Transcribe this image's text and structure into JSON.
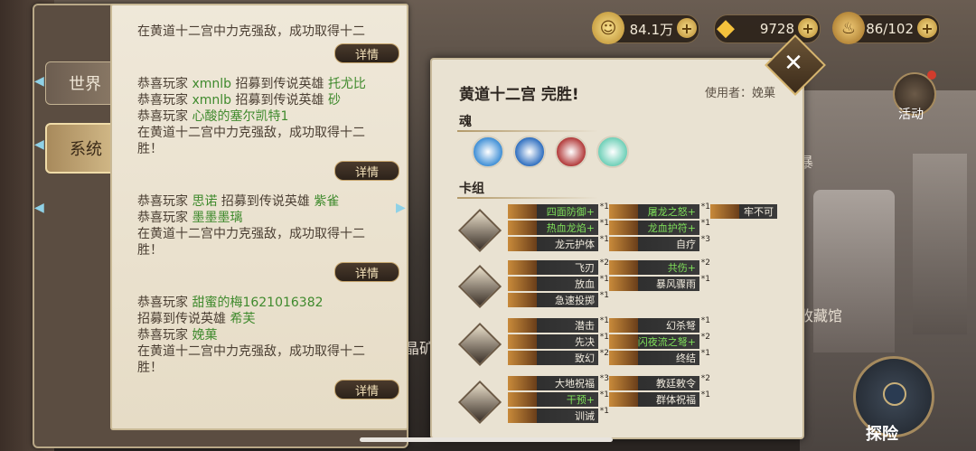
{
  "resources": [
    {
      "icon": "gold-coin-icon",
      "value": "84.1万"
    },
    {
      "icon": "diamond-icon",
      "value": "9728"
    },
    {
      "icon": "stamina-icon",
      "value": "86/102"
    }
  ],
  "chat": {
    "tabs": [
      {
        "label": "世界"
      },
      {
        "label": "系统"
      }
    ],
    "detail_label": "详情",
    "messages": [
      {
        "lines": [
          {
            "parts": [
              {
                "t": "在黄道十二宫中力克强敌，成功取得十二"
              }
            ]
          }
        ]
      },
      {
        "lines": [
          {
            "parts": [
              {
                "t": "恭喜玩家 "
              },
              {
                "t": "xmnlb",
                "hl": true
              },
              {
                "t": " 招募到传说英雄 "
              },
              {
                "t": "托尤比",
                "hl": true
              }
            ]
          },
          {
            "parts": [
              {
                "t": "恭喜玩家 "
              },
              {
                "t": "xmnlb",
                "hl": true
              },
              {
                "t": " 招募到传说英雄 "
              },
              {
                "t": "砂",
                "hl": true
              }
            ]
          },
          {
            "parts": [
              {
                "t": "恭喜玩家 "
              },
              {
                "t": "心酸的塞尔凯特1",
                "hl": true
              }
            ]
          },
          {
            "parts": [
              {
                "t": "在黄道十二宫中力克强敌，成功取得十二"
              }
            ]
          },
          {
            "parts": [
              {
                "t": "胜！"
              }
            ]
          }
        ]
      },
      {
        "lines": [
          {
            "parts": [
              {
                "t": "恭喜玩家 "
              },
              {
                "t": "思诺",
                "hl": true
              },
              {
                "t": " 招募到传说英雄 "
              },
              {
                "t": "紫雀",
                "hl": true
              }
            ]
          },
          {
            "parts": [
              {
                "t": "恭喜玩家 "
              },
              {
                "t": "墨墨墨璃",
                "hl": true
              }
            ]
          },
          {
            "parts": [
              {
                "t": "在黄道十二宫中力克强敌，成功取得十二"
              }
            ]
          },
          {
            "parts": [
              {
                "t": "胜！"
              }
            ]
          }
        ]
      },
      {
        "lines": [
          {
            "parts": [
              {
                "t": "恭喜玩家 "
              },
              {
                "t": "甜蜜的梅1621016382",
                "hl": true
              }
            ]
          },
          {
            "parts": [
              {
                "t": "招募到传说英雄 "
              },
              {
                "t": "希芙",
                "hl": true
              }
            ]
          },
          {
            "parts": [
              {
                "t": "恭喜玩家 "
              },
              {
                "t": "娩菓",
                "hl": true
              }
            ]
          },
          {
            "parts": [
              {
                "t": "在黄道十二宫中力克强敌，成功取得十二"
              }
            ]
          },
          {
            "parts": [
              {
                "t": "胜！"
              }
            ]
          }
        ]
      }
    ]
  },
  "dialog": {
    "title": "黄道十二宫 完胜!",
    "user": "使用者：娩菓",
    "soul_label": "魂",
    "deck_label": "卡组",
    "close_icon": "close-icon",
    "souls": [
      {
        "icon": "soul-ice-icon",
        "color": "#3f8fd6"
      },
      {
        "icon": "soul-water-icon",
        "color": "#2f6fc0"
      },
      {
        "icon": "soul-fire-icon",
        "color": "#b23a3a"
      },
      {
        "icon": "soul-wind-icon",
        "color": "#6fd0b8"
      }
    ],
    "deck": [
      {
        "cards": [
          {
            "name": "四面防御+",
            "count": "*1",
            "green": true,
            "col": 0
          },
          {
            "name": "热血龙焰+",
            "count": "*1",
            "green": true,
            "col": 0
          },
          {
            "name": "龙元护体",
            "count": "*1",
            "col": 0
          },
          {
            "name": "屠龙之怒+",
            "count": "*1",
            "green": true,
            "col": 1
          },
          {
            "name": "龙血护符+",
            "count": "*1",
            "green": true,
            "col": 1
          },
          {
            "name": "自疗",
            "count": "*3",
            "col": 1
          },
          {
            "name": "牢不可",
            "count": "",
            "col": 2
          }
        ]
      },
      {
        "cards": [
          {
            "name": "飞刃",
            "count": "*2",
            "col": 0
          },
          {
            "name": "放血",
            "count": "*1",
            "col": 0
          },
          {
            "name": "急速投掷",
            "count": "*1",
            "col": 0
          },
          {
            "name": "共伤+",
            "count": "*2",
            "green": true,
            "col": 1
          },
          {
            "name": "暴风骤雨",
            "count": "*1",
            "col": 1
          }
        ]
      },
      {
        "cards": [
          {
            "name": "潜击",
            "count": "*1",
            "col": 0
          },
          {
            "name": "先决",
            "count": "*1",
            "col": 0
          },
          {
            "name": "致幻",
            "count": "*2",
            "col": 0
          },
          {
            "name": "幻杀弩",
            "count": "*1",
            "col": 1
          },
          {
            "name": "闪夜流之弩+",
            "count": "*2",
            "green": true,
            "col": 1
          },
          {
            "name": "终结",
            "count": "*1",
            "col": 1
          }
        ]
      },
      {
        "cards": [
          {
            "name": "大地祝福",
            "count": "*3",
            "col": 0
          },
          {
            "name": "干预+",
            "count": "*1",
            "green": true,
            "col": 0
          },
          {
            "name": "训诫",
            "count": "*1",
            "col": 0
          },
          {
            "name": "教廷敕令",
            "count": "*2",
            "col": 1
          },
          {
            "name": "群体祝福",
            "count": "*1",
            "col": 1
          }
        ]
      }
    ]
  },
  "side": {
    "activity_label": "活动",
    "explore_label": "探险",
    "bg_label_collection": "收藏馆",
    "bg_label_mine": "晶矿",
    "bg_label_fragment": "暴"
  }
}
